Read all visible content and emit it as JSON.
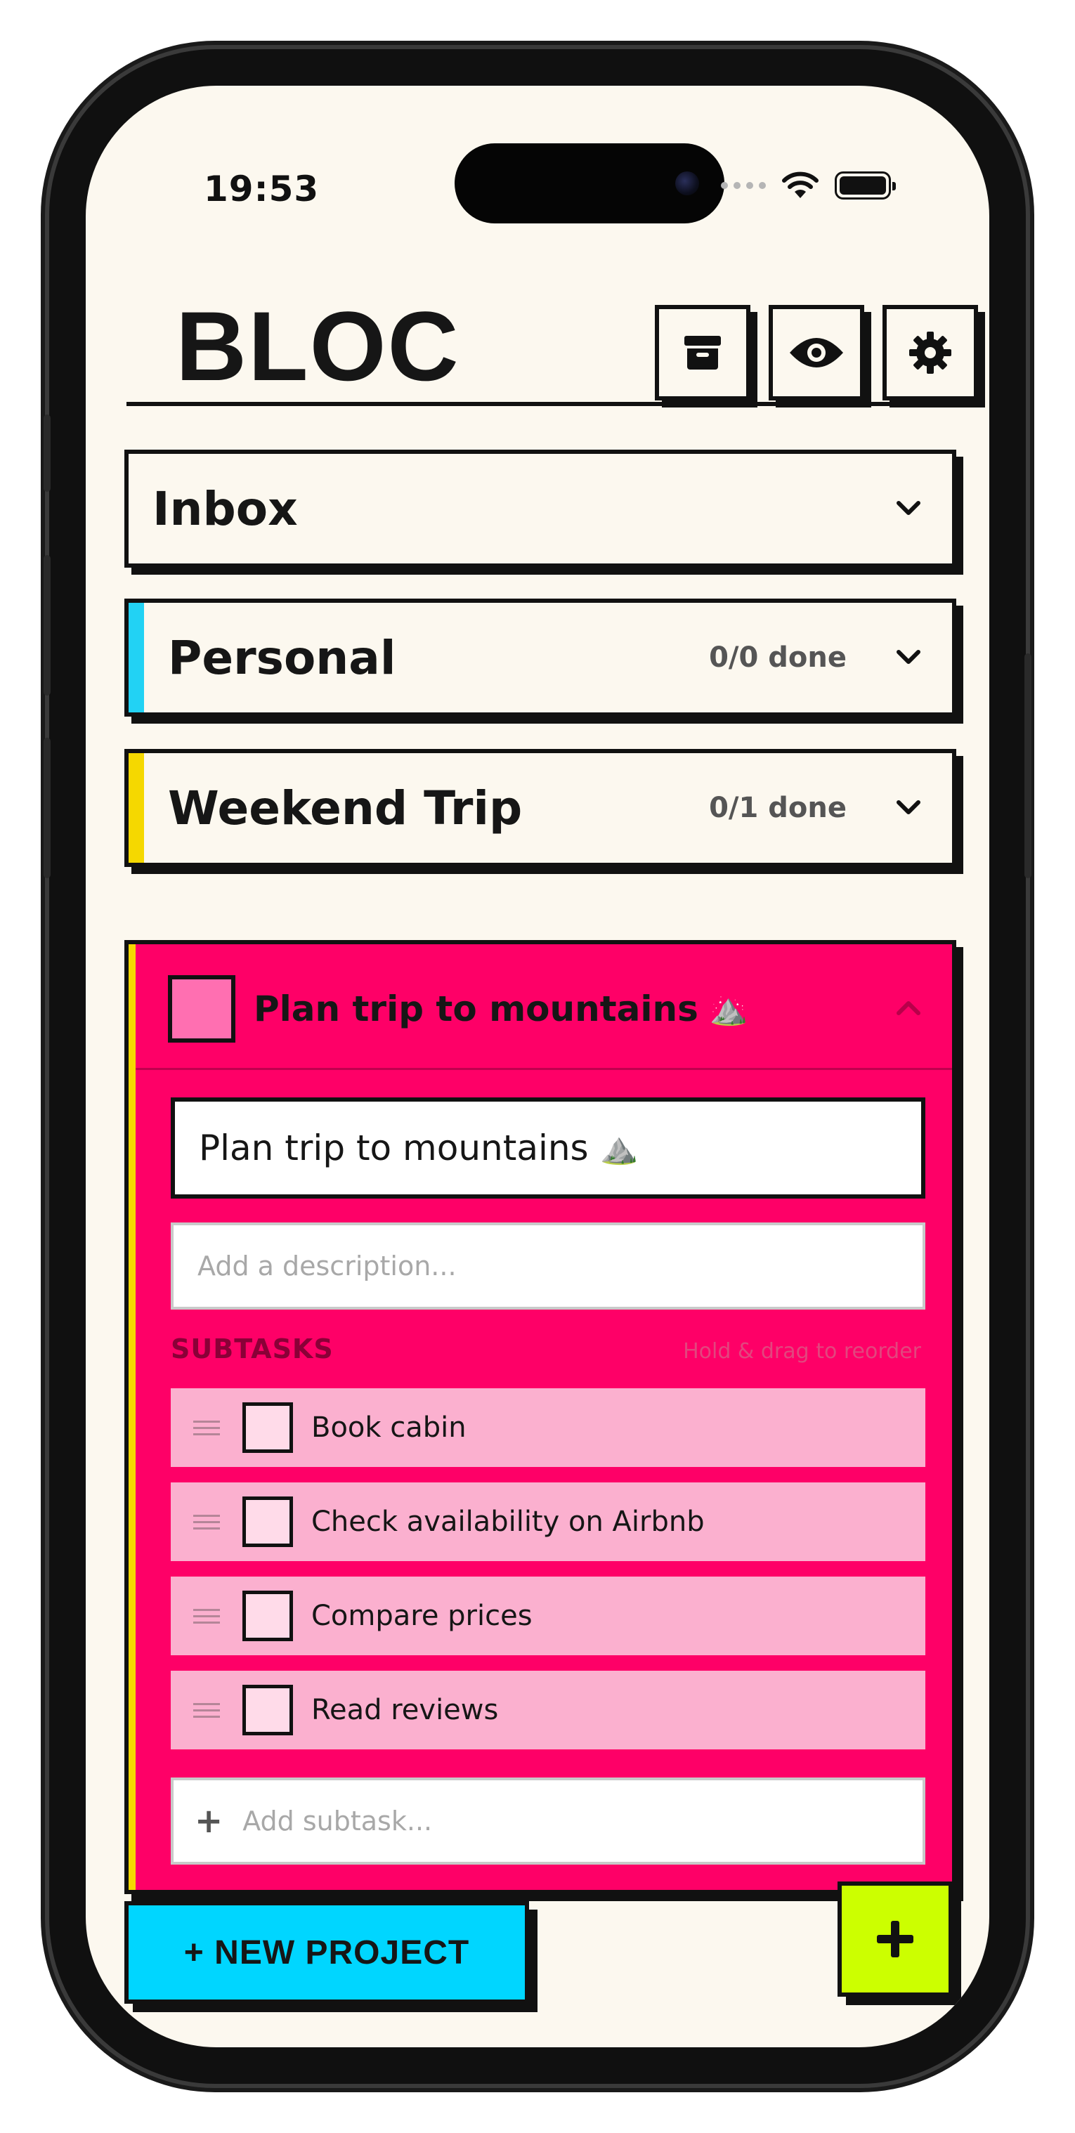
{
  "status_bar": {
    "time": "19:53"
  },
  "app": {
    "logo": "BLOC",
    "header_icons": [
      "archive-icon",
      "eye-icon",
      "gear-icon"
    ]
  },
  "projects": [
    {
      "name": "Inbox",
      "count": "",
      "color": ""
    },
    {
      "name": "Personal",
      "count": "0/0 done",
      "color": "#22d2f4"
    },
    {
      "name": "Weekend Trip",
      "count": "0/1 done",
      "color": "#f5d800"
    }
  ],
  "task": {
    "title": "Plan trip to mountains",
    "emoji": "⛰️",
    "title_value": "Plan trip to mountains",
    "description_placeholder": "Add a description...",
    "subtasks_label": "SUBTASKS",
    "subtasks_hint": "Hold & drag to reorder",
    "subtasks": [
      {
        "label": "Book cabin"
      },
      {
        "label": "Check availability on Airbnb"
      },
      {
        "label": "Compare prices"
      },
      {
        "label": "Read reviews"
      }
    ],
    "add_subtask_placeholder": "Add subtask...",
    "color": "#fe0067"
  },
  "buttons": {
    "new_project": "+ NEW PROJECT",
    "fab_icon": "plus-icon"
  },
  "colors": {
    "background": "#fcf8ef",
    "accent_cyan": "#00d6ff",
    "accent_lime": "#ccff00",
    "accent_pink": "#fe0067",
    "accent_yellow": "#f5d800"
  }
}
